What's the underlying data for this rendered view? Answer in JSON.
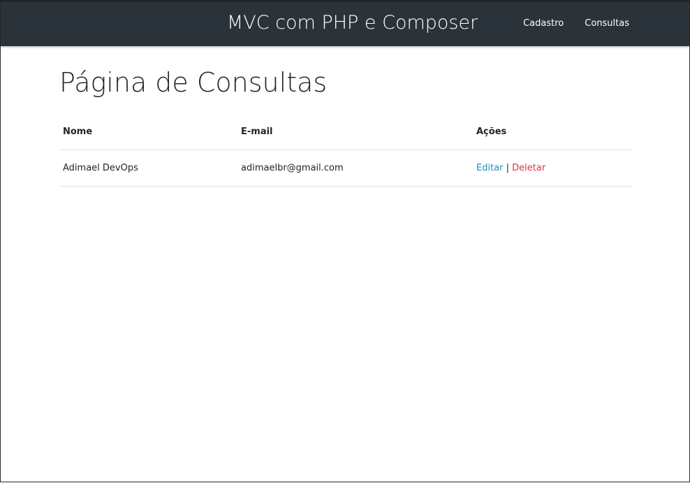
{
  "navbar": {
    "brand": "MVC com PHP e Composer",
    "links": [
      {
        "label": "Cadastro"
      },
      {
        "label": "Consultas"
      }
    ]
  },
  "page": {
    "title": "Página de Consultas"
  },
  "table": {
    "headers": [
      "Nome",
      "E-mail",
      "Ações"
    ],
    "rows": [
      {
        "name": "Adimael DevOps",
        "email": "adimaelbr@gmail.com",
        "edit_label": "Editar",
        "separator": "|",
        "delete_label": "Deletar"
      }
    ]
  },
  "colors": {
    "navbar_bg": "#2b333a",
    "edit_link": "#1e8fc6",
    "delete_link": "#dc3545",
    "text": "#212529"
  }
}
